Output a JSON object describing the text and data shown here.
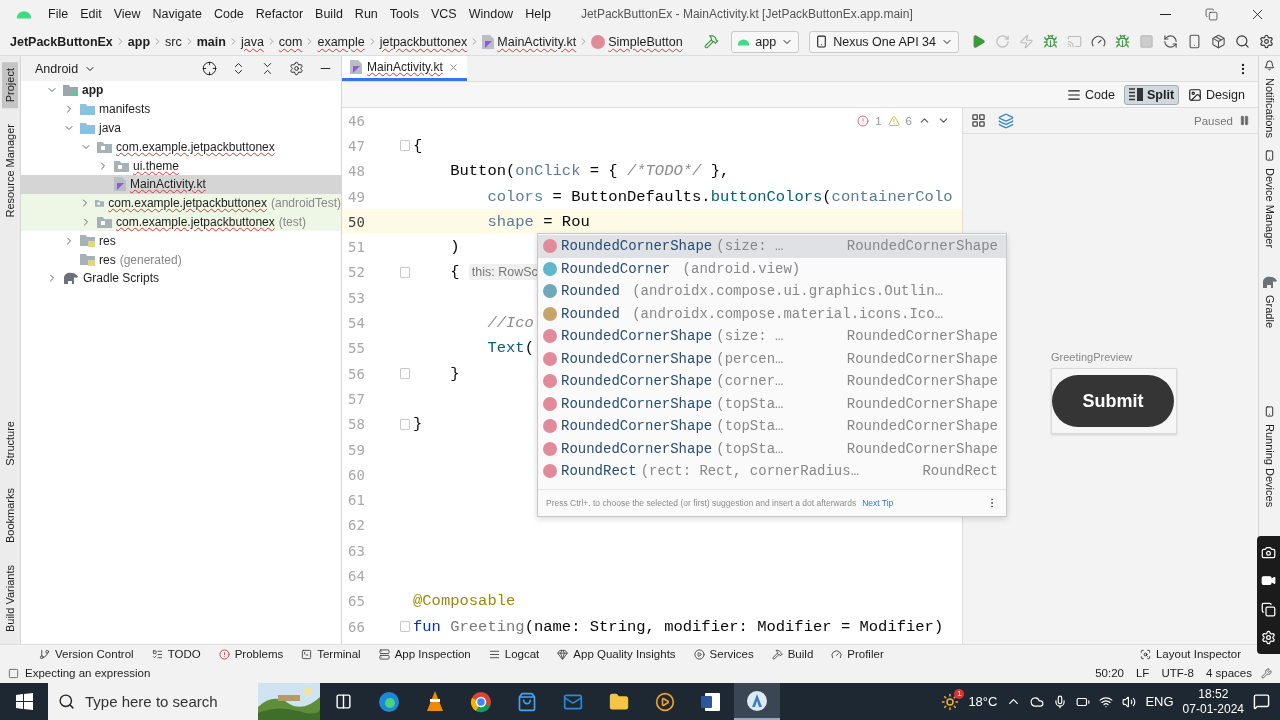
{
  "menu_bar": {
    "items": [
      "File",
      "Edit",
      "View",
      "Navigate",
      "Code",
      "Refactor",
      "Build",
      "Run",
      "Tools",
      "VCS",
      "Window",
      "Help"
    ],
    "title": "JetPackButtonEx - MainActivity.kt [JetPackButtonEx.app.main]"
  },
  "breadcrumbs": [
    {
      "label": "JetPackButtonEx",
      "kind": "text",
      "bold": true,
      "error": false
    },
    {
      "label": "app",
      "kind": "text",
      "bold": true,
      "error": false
    },
    {
      "label": "src",
      "kind": "text",
      "bold": false,
      "error": false
    },
    {
      "label": "main",
      "kind": "text",
      "bold": true,
      "error": false
    },
    {
      "label": "java",
      "kind": "text",
      "bold": false,
      "error": true
    },
    {
      "label": "com",
      "kind": "text",
      "bold": false,
      "error": true
    },
    {
      "label": "example",
      "kind": "text",
      "bold": false,
      "error": true
    },
    {
      "label": "jetpackbuttonex",
      "kind": "text",
      "bold": false,
      "error": true
    },
    {
      "label": "MainActivity.kt",
      "kind": "file",
      "bold": false,
      "error": true
    },
    {
      "label": "SimpleButton",
      "kind": "function",
      "bold": false,
      "error": true
    }
  ],
  "run_toolbar": {
    "configuration": "app",
    "device": "Nexus One API 34"
  },
  "left_tool_strip": {
    "top": [
      {
        "label": "Project",
        "selected": true
      },
      {
        "label": "Resource Manager",
        "selected": false
      }
    ],
    "bottom": [
      {
        "label": "Structure",
        "selected": false
      },
      {
        "label": "Bookmarks",
        "selected": false
      },
      {
        "label": "Build Variants",
        "selected": false
      }
    ]
  },
  "project_panel": {
    "view": "Android",
    "tree": [
      {
        "label": "app",
        "kind": "module",
        "expanded": true,
        "selected": false,
        "test_scope": false,
        "children": [
          {
            "label": "manifests",
            "kind": "folder",
            "expanded": false,
            "selected": false,
            "test_scope": false
          },
          {
            "label": "java",
            "kind": "folder",
            "expanded": true,
            "selected": false,
            "test_scope": false,
            "children": [
              {
                "label": "com.example.jetpackbuttonex",
                "kind": "package",
                "expanded": true,
                "selected": false,
                "test_scope": false,
                "children": [
                  {
                    "label": "ui.theme",
                    "kind": "package",
                    "expanded": false,
                    "selected": false,
                    "test_scope": false
                  },
                  {
                    "label": "MainActivity.kt",
                    "kind": "file",
                    "selected": true,
                    "test_scope": false
                  }
                ]
              },
              {
                "label": "com.example.jetpackbuttonex",
                "suffix": "(androidTest)",
                "kind": "package",
                "expanded": false,
                "selected": false,
                "test_scope": true
              },
              {
                "label": "com.example.jetpackbuttonex",
                "suffix": "(test)",
                "kind": "package",
                "expanded": false,
                "selected": false,
                "test_scope": true
              }
            ]
          },
          {
            "label": "res",
            "kind": "res",
            "expanded": false,
            "selected": false,
            "test_scope": false
          },
          {
            "label": "res",
            "suffix": "(generated)",
            "kind": "res",
            "selected": false,
            "test_scope": false
          }
        ]
      },
      {
        "label": "Gradle Scripts",
        "kind": "gradle",
        "expanded": false,
        "selected": false,
        "test_scope": false
      }
    ]
  },
  "editor_tabs": [
    {
      "label": "MainActivity.kt",
      "selected": true
    }
  ],
  "view_modes": [
    {
      "label": "Code",
      "selected": false
    },
    {
      "label": "Split",
      "selected": true
    },
    {
      "label": "Design",
      "selected": false
    }
  ],
  "inspections": {
    "errors": "1",
    "warnings": "6"
  },
  "code_lines": [
    {
      "number": "46",
      "current": false,
      "fold": false
    },
    {
      "number": "47",
      "current": false,
      "fold": true,
      "tokens": [
        {
          "kind": "plain",
          "text": "{"
        }
      ]
    },
    {
      "number": "48",
      "current": false,
      "fold": false,
      "tokens": [
        {
          "kind": "plain",
          "text": "    Button("
        },
        {
          "kind": "param",
          "text": "onClick"
        },
        {
          "kind": "plain",
          "text": " = { "
        },
        {
          "kind": "comment",
          "text": "/*TODO*/"
        },
        {
          "kind": "plain",
          "text": " },"
        }
      ]
    },
    {
      "number": "49",
      "current": false,
      "fold": false,
      "tokens": [
        {
          "kind": "param",
          "text": "        colors"
        },
        {
          "kind": "plain",
          "text": " = ButtonDefaults."
        },
        {
          "kind": "fn",
          "text": "buttonColors"
        },
        {
          "kind": "plain",
          "text": "("
        },
        {
          "kind": "param",
          "text": "containerColo"
        }
      ]
    },
    {
      "number": "50",
      "current": true,
      "fold": false,
      "tokens": [
        {
          "kind": "param",
          "text": "        shape"
        },
        {
          "kind": "plain",
          "text": " = Rou"
        }
      ]
    },
    {
      "number": "51",
      "current": false,
      "fold": false,
      "tokens": [
        {
          "kind": "plain",
          "text": "    )"
        }
      ]
    },
    {
      "number": "52",
      "current": false,
      "fold": true,
      "tokens": [
        {
          "kind": "plain",
          "text": "    { "
        },
        {
          "kind": "hint",
          "text": "this: RowSc"
        }
      ]
    },
    {
      "number": "53",
      "current": false,
      "fold": false
    },
    {
      "number": "54",
      "current": false,
      "fold": false,
      "tokens": [
        {
          "kind": "comment",
          "text": "        //Ico"
        }
      ]
    },
    {
      "number": "55",
      "current": false,
      "fold": false,
      "tokens": [
        {
          "kind": "fn",
          "text": "        Text"
        },
        {
          "kind": "plain",
          "text": "("
        }
      ]
    },
    {
      "number": "56",
      "current": false,
      "fold": true,
      "tokens": [
        {
          "kind": "plain",
          "text": "    }"
        }
      ]
    },
    {
      "number": "57",
      "current": false,
      "fold": false
    },
    {
      "number": "58",
      "current": false,
      "fold": true,
      "tokens": [
        {
          "kind": "plain",
          "text": "}"
        }
      ]
    },
    {
      "number": "59",
      "current": false,
      "fold": false
    },
    {
      "number": "60",
      "current": false,
      "fold": false
    },
    {
      "number": "61",
      "current": false,
      "fold": false
    },
    {
      "number": "62",
      "current": false,
      "fold": false
    },
    {
      "number": "63",
      "current": false,
      "fold": false
    },
    {
      "number": "64",
      "current": false,
      "fold": false
    },
    {
      "number": "65",
      "current": false,
      "fold": false,
      "tokens": [
        {
          "kind": "annotation",
          "text": "@Composable"
        }
      ]
    },
    {
      "number": "66",
      "current": false,
      "fold": true,
      "tokens": [
        {
          "kind": "keyword",
          "text": "fun"
        },
        {
          "kind": "unused",
          "text": " Greeting"
        },
        {
          "kind": "plain",
          "text": "(name: String, modifier: Modifier = Modifier)"
        }
      ]
    }
  ],
  "completion": {
    "items": [
      {
        "kind": "function",
        "name": "RoundedCornerShape",
        "detail": "(size: …",
        "type": "RoundedCornerShape",
        "selected": true
      },
      {
        "kind": "class",
        "name": "RoundedCorner",
        "detail": " (android.view)",
        "selected": false
      },
      {
        "kind": "object",
        "name": "Rounded",
        "detail": " (androidx.compose.ui.graphics.Outlin…",
        "selected": false
      },
      {
        "kind": "icon_object",
        "name": "Rounded",
        "detail": " (androidx.compose.material.icons.Ico…",
        "selected": false
      },
      {
        "kind": "function",
        "name": "RoundedCornerShape",
        "detail": "(size: …",
        "type": "RoundedCornerShape",
        "selected": false
      },
      {
        "kind": "function",
        "name": "RoundedCornerShape",
        "detail": "(percen…",
        "type": "RoundedCornerShape",
        "selected": false
      },
      {
        "kind": "function",
        "name": "RoundedCornerShape",
        "detail": "(corner…",
        "type": "RoundedCornerShape",
        "selected": false
      },
      {
        "kind": "function",
        "name": "RoundedCornerShape",
        "detail": "(topSta…",
        "type": "RoundedCornerShape",
        "selected": false
      },
      {
        "kind": "function",
        "name": "RoundedCornerShape",
        "detail": "(topSta…",
        "type": "RoundedCornerShape",
        "selected": false
      },
      {
        "kind": "function",
        "name": "RoundedCornerShape",
        "detail": "(topSta…",
        "type": "RoundedCornerShape",
        "selected": false
      },
      {
        "kind": "function",
        "name": "RoundRect",
        "detail": "(rect: Rect, cornerRadius…",
        "type": "RoundRect",
        "selected": false
      }
    ],
    "hint": "Press Ctrl+. to choose the selected (or first) suggestion and insert a dot afterwards",
    "tip_link": "Next Tip"
  },
  "preview": {
    "status": "Paused",
    "label": "GreetingPreview",
    "button": "Submit"
  },
  "right_tool_strip": [
    "Notifications",
    "Device Manager",
    "Gradle",
    "Running Devices"
  ],
  "bottom_tools": {
    "left": [
      "Version Control",
      "TODO",
      "Problems",
      "Terminal",
      "App Inspection",
      "Logcat",
      "App Quality Insights",
      "Services",
      "Build",
      "Profiler"
    ],
    "right": [
      "Layout Inspector"
    ]
  },
  "status_bar": {
    "message": "Expecting an expression",
    "items": [
      "50:20",
      "LF",
      "UTF-8",
      "4 spaces"
    ]
  },
  "taskbar": {
    "search_placeholder": "Type here to search",
    "weather_badge": "1",
    "temperature": "18°C",
    "language": "ENG",
    "time": "18:52",
    "date": "07-01-2024"
  }
}
